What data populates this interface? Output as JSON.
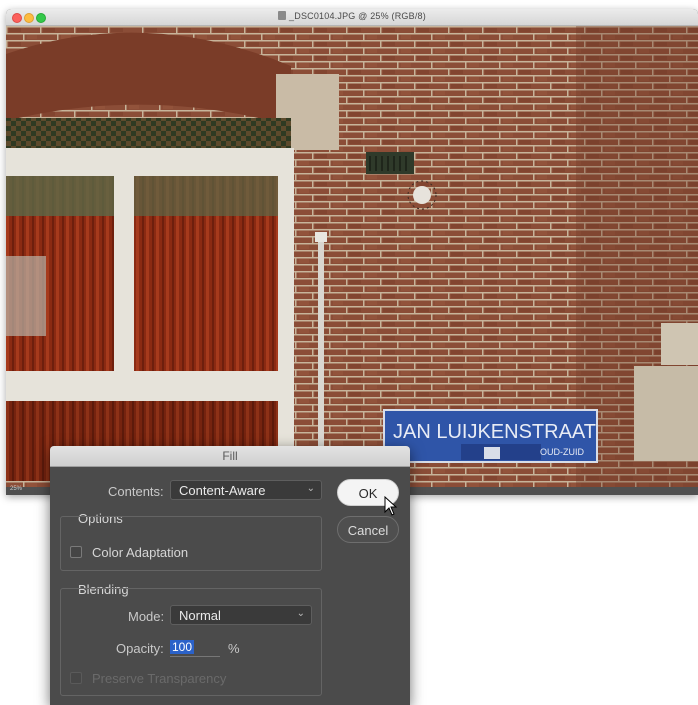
{
  "window": {
    "title": "_DSC0104.JPG @ 25% (RGB/8)",
    "zoom": "25%"
  },
  "photo": {
    "sign_main": "JAN LUIJKENSTRAAT",
    "sign_sub": "OUD-ZUID"
  },
  "dialog": {
    "title": "Fill",
    "contents_label": "Contents:",
    "contents_value": "Content-Aware",
    "ok_label": "OK",
    "cancel_label": "Cancel",
    "options": {
      "title": "Options",
      "color_adaptation_label": "Color Adaptation",
      "color_adaptation_checked": false
    },
    "blending": {
      "title": "Blending",
      "mode_label": "Mode:",
      "mode_value": "Normal",
      "opacity_label": "Opacity:",
      "opacity_value": "100",
      "opacity_unit": "%",
      "preserve_label": "Preserve Transparency",
      "preserve_checked": false,
      "preserve_enabled": false
    }
  },
  "colors": {
    "brick": "#8a4a35",
    "sign_blue": "#2f55a8",
    "dialog_bg": "#4b4b4b",
    "selection": "#2b62c9"
  }
}
